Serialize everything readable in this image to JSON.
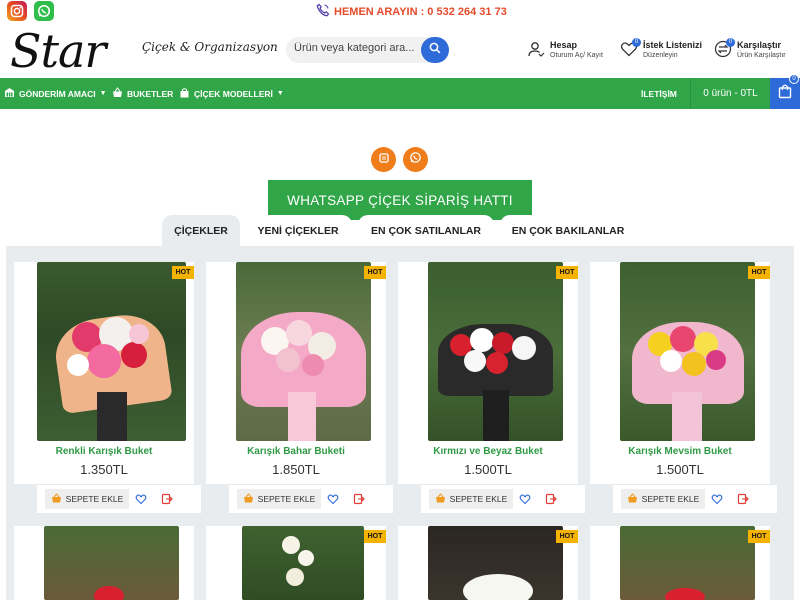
{
  "topbar": {
    "instagram_icon": "instagram-icon",
    "whatsapp_icon": "whatsapp-icon",
    "phone_text": "HEMEN ARAYIN : 0 532 264 31 73",
    "phone_icon": "phone-icon"
  },
  "brand": {
    "logo_text": "Star",
    "logo_subtitle": "Çiçek & Organizasyon"
  },
  "search": {
    "placeholder": "Ürün veya kategori ara..."
  },
  "header": {
    "account_title": "Hesap",
    "account_sub": "Oturum Aç/ Kayıt",
    "wishlist_title": "İstek Listenizi",
    "wishlist_sub": "Düzenleyin",
    "wishlist_count": "0",
    "compare_title": "Karşılaştır",
    "compare_sub": "Ürün Karşılaştır",
    "compare_count": "0"
  },
  "nav": {
    "items": [
      {
        "label": "GÖNDERİM AMACI",
        "dropdown": true
      },
      {
        "label": "BUKETLER",
        "dropdown": false
      },
      {
        "label": "ÇİÇEK MODELLERİ",
        "dropdown": true
      }
    ],
    "contact": "İLETİŞİM",
    "cart_summary": "0 ürün - 0TL",
    "cart_count": "0"
  },
  "banner": {
    "title": "WHATSAPP ÇİÇEK SİPARİŞ HATTI"
  },
  "tabs": [
    {
      "label": "ÇİÇEKLER",
      "active": true
    },
    {
      "label": "YENİ ÇİÇEKLER",
      "active": false
    },
    {
      "label": "EN ÇOK SATILANLAR",
      "active": false
    },
    {
      "label": "EN ÇOK BAKILANLAR",
      "active": false
    }
  ],
  "products": [
    {
      "name": "Renkli Karışık Buket",
      "price": "1.350TL",
      "badge": "HOT"
    },
    {
      "name": "Karışık Bahar Buketi",
      "price": "1.850TL",
      "badge": "HOT"
    },
    {
      "name": "Kırmızı ve Beyaz Buket",
      "price": "1.500TL",
      "badge": "HOT"
    },
    {
      "name": "Karışık Mevsim Buket",
      "price": "1.500TL",
      "badge": "HOT"
    }
  ],
  "second_row_badges": [
    "HOT",
    "HOT",
    "HOT"
  ],
  "add_to_cart_label": "SEPETE EKLE",
  "colors": {
    "green": "#31a648",
    "blue": "#2e6bd9",
    "orange": "#ef7d1a",
    "hot_badge": "#f5b301",
    "phone_red": "#e34b2b"
  }
}
